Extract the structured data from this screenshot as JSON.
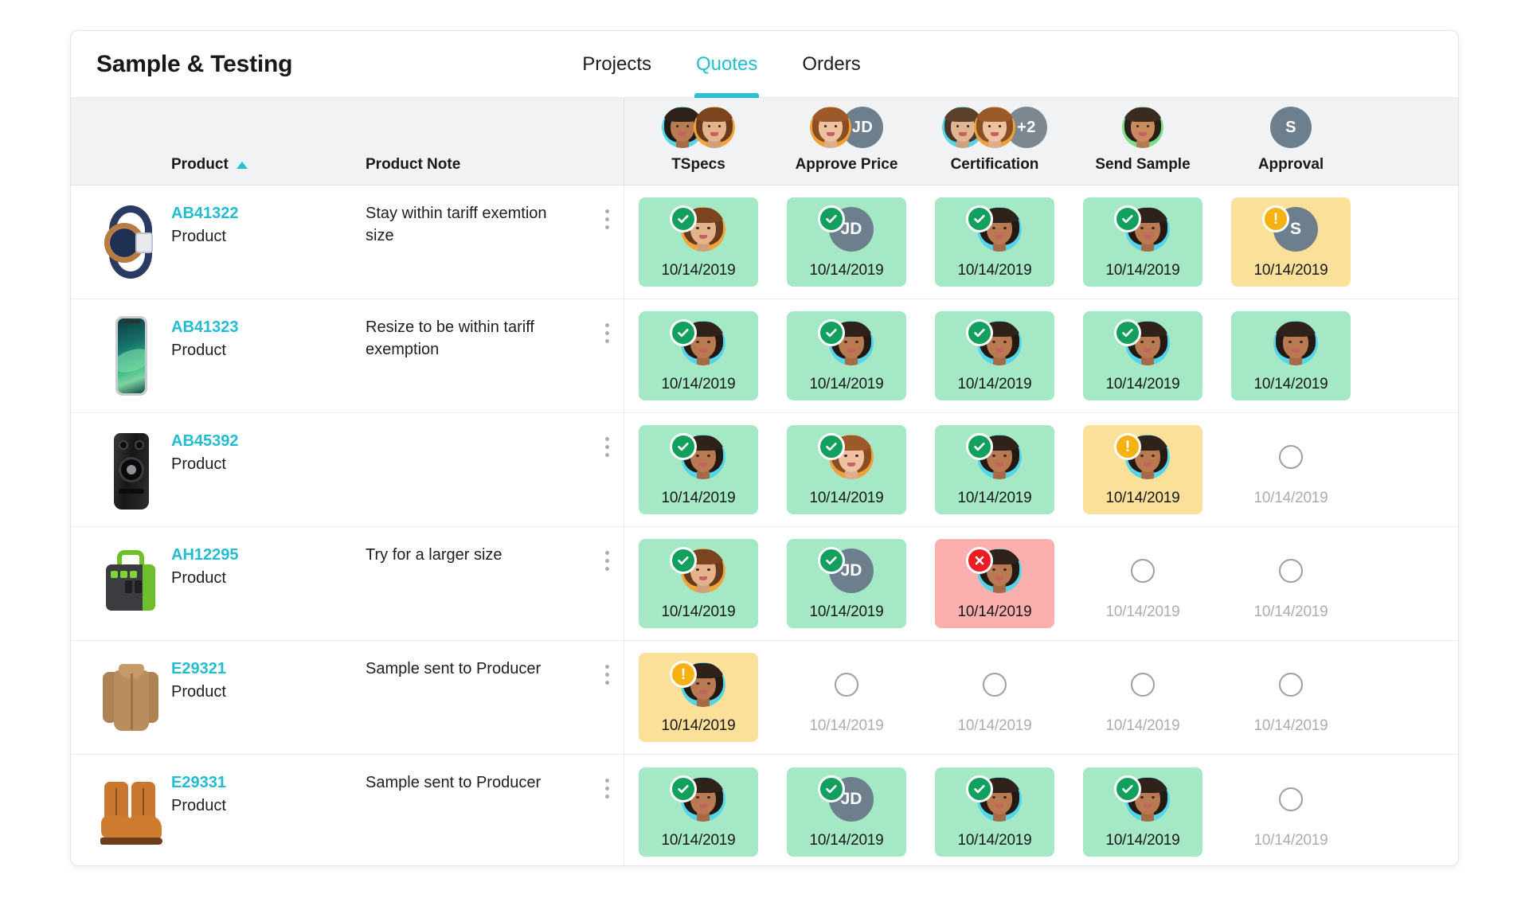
{
  "header": {
    "title": "Sample & Testing",
    "tabs": [
      {
        "label": "Projects",
        "active": false
      },
      {
        "label": "Quotes",
        "active": true
      },
      {
        "label": "Orders",
        "active": false
      }
    ]
  },
  "table": {
    "columns": {
      "product": "Product",
      "product_note": "Product Note",
      "sort_indicator": "ascending"
    },
    "stages": [
      {
        "name": "TSpecs",
        "avatars": [
          {
            "type": "photo",
            "variant": "f1"
          },
          {
            "type": "photo",
            "variant": "f2"
          }
        ]
      },
      {
        "name": "Approve Price",
        "avatars": [
          {
            "type": "photo",
            "variant": "f3"
          },
          {
            "type": "initials",
            "label": "JD"
          }
        ]
      },
      {
        "name": "Certification",
        "avatars": [
          {
            "type": "photo",
            "variant": "m1"
          },
          {
            "type": "photo",
            "variant": "f3"
          },
          {
            "type": "initials",
            "label": "+2"
          }
        ]
      },
      {
        "name": "Send Sample",
        "avatars": [
          {
            "type": "photo",
            "variant": "f4"
          }
        ]
      },
      {
        "name": "Approval",
        "avatars": [
          {
            "type": "initials",
            "label": "S"
          }
        ]
      }
    ],
    "rows": [
      {
        "thumb": "smartwatch",
        "product_id": "AB41322",
        "product_label": "Product",
        "note": "Stay within tariff exemtion size",
        "kebab": "row-menu",
        "cells": [
          {
            "status": "approved",
            "badge": "check",
            "avatar": {
              "type": "photo",
              "variant": "f2"
            },
            "date": "10/14/2019"
          },
          {
            "status": "approved",
            "badge": "check",
            "avatar": {
              "type": "initials",
              "label": "JD"
            },
            "date": "10/14/2019"
          },
          {
            "status": "approved",
            "badge": "check",
            "avatar": {
              "type": "photo",
              "variant": "f1"
            },
            "date": "10/14/2019"
          },
          {
            "status": "approved",
            "badge": "check",
            "avatar": {
              "type": "photo",
              "variant": "f1"
            },
            "date": "10/14/2019"
          },
          {
            "status": "warning",
            "badge": "warn",
            "avatar": {
              "type": "initials",
              "label": "S"
            },
            "date": "10/14/2019"
          }
        ]
      },
      {
        "thumb": "smartphone",
        "product_id": "AB41323",
        "product_label": "Product",
        "note": "Resize to be within tariff exemption",
        "kebab": "row-menu",
        "cells": [
          {
            "status": "approved",
            "badge": "check",
            "avatar": {
              "type": "photo",
              "variant": "f1"
            },
            "date": "10/14/2019"
          },
          {
            "status": "approved",
            "badge": "check",
            "avatar": {
              "type": "photo",
              "variant": "f1"
            },
            "date": "10/14/2019"
          },
          {
            "status": "approved",
            "badge": "check",
            "avatar": {
              "type": "photo",
              "variant": "f1"
            },
            "date": "10/14/2019"
          },
          {
            "status": "approved",
            "badge": "check",
            "avatar": {
              "type": "photo",
              "variant": "f1"
            },
            "date": "10/14/2019"
          },
          {
            "status": "approved",
            "badge": "none",
            "avatar": {
              "type": "photo",
              "variant": "f1"
            },
            "date": "10/14/2019"
          }
        ]
      },
      {
        "thumb": "speaker",
        "product_id": "AB45392",
        "product_label": "Product",
        "note": "",
        "kebab": "row-menu",
        "cells": [
          {
            "status": "approved",
            "badge": "check",
            "avatar": {
              "type": "photo",
              "variant": "f1"
            },
            "date": "10/14/2019"
          },
          {
            "status": "approved",
            "badge": "check",
            "avatar": {
              "type": "photo",
              "variant": "f3"
            },
            "date": "10/14/2019"
          },
          {
            "status": "approved",
            "badge": "check",
            "avatar": {
              "type": "photo",
              "variant": "f1"
            },
            "date": "10/14/2019"
          },
          {
            "status": "warning",
            "badge": "warn",
            "avatar": {
              "type": "photo",
              "variant": "f1"
            },
            "date": "10/14/2019"
          },
          {
            "status": "empty",
            "badge": "none",
            "avatar": null,
            "date": "10/14/2019"
          }
        ]
      },
      {
        "thumb": "generator",
        "product_id": "AH12295",
        "product_label": "Product",
        "note": "Try for a larger size",
        "kebab": "row-menu",
        "cells": [
          {
            "status": "approved",
            "badge": "check",
            "avatar": {
              "type": "photo",
              "variant": "f2"
            },
            "date": "10/14/2019"
          },
          {
            "status": "approved",
            "badge": "check",
            "avatar": {
              "type": "initials",
              "label": "JD"
            },
            "date": "10/14/2019"
          },
          {
            "status": "rejected",
            "badge": "x",
            "avatar": {
              "type": "photo",
              "variant": "f1"
            },
            "date": "10/14/2019"
          },
          {
            "status": "empty",
            "badge": "none",
            "avatar": null,
            "date": "10/14/2019"
          },
          {
            "status": "empty",
            "badge": "none",
            "avatar": null,
            "date": "10/14/2019"
          }
        ]
      },
      {
        "thumb": "shirt",
        "product_id": "E29321",
        "product_label": "Product",
        "note": "Sample sent to Producer",
        "kebab": "row-menu",
        "cells": [
          {
            "status": "warning",
            "badge": "warn",
            "avatar": {
              "type": "photo",
              "variant": "f1"
            },
            "date": "10/14/2019"
          },
          {
            "status": "empty",
            "badge": "none",
            "avatar": null,
            "date": "10/14/2019"
          },
          {
            "status": "empty",
            "badge": "none",
            "avatar": null,
            "date": "10/14/2019"
          },
          {
            "status": "empty",
            "badge": "none",
            "avatar": null,
            "date": "10/14/2019"
          },
          {
            "status": "empty",
            "badge": "none",
            "avatar": null,
            "date": "10/14/2019"
          }
        ]
      },
      {
        "thumb": "boots",
        "product_id": "E29331",
        "product_label": "Product",
        "note": "Sample sent to Producer",
        "kebab": "row-menu",
        "cells": [
          {
            "status": "approved",
            "badge": "check",
            "avatar": {
              "type": "photo",
              "variant": "f1"
            },
            "date": "10/14/2019"
          },
          {
            "status": "approved",
            "badge": "check",
            "avatar": {
              "type": "initials",
              "label": "JD"
            },
            "date": "10/14/2019"
          },
          {
            "status": "approved",
            "badge": "check",
            "avatar": {
              "type": "photo",
              "variant": "f1"
            },
            "date": "10/14/2019"
          },
          {
            "status": "approved",
            "badge": "check",
            "avatar": {
              "type": "photo",
              "variant": "f1"
            },
            "date": "10/14/2019"
          },
          {
            "status": "empty",
            "badge": "none",
            "avatar": null,
            "date": "10/14/2019"
          }
        ]
      }
    ]
  },
  "colors": {
    "accent": "#2bbfd4",
    "link": "#23bcd1",
    "approved_bg": "#a4e8c6",
    "warning_bg": "#fbe09a",
    "rejected_bg": "#fbb0ad",
    "badge_check": "#13a05f",
    "badge_warn": "#f5b212",
    "badge_x": "#ee1c25",
    "initials_bg": "#6d7f8c",
    "header_bg": "#f1f2f3"
  }
}
